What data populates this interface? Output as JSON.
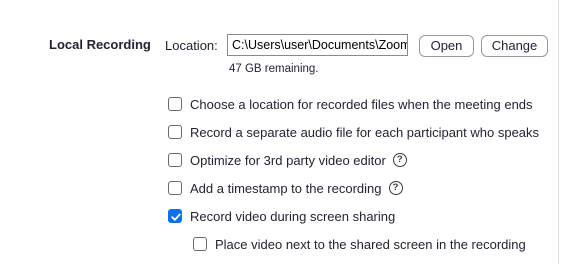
{
  "section": {
    "title": "Local Recording"
  },
  "location": {
    "label": "Location:",
    "value": "C:\\Users\\user\\Documents\\Zoom",
    "open_label": "Open",
    "change_label": "Change",
    "remaining": "47 GB remaining."
  },
  "options": [
    {
      "label": "Choose a location for recorded files when the meeting ends",
      "checked": false,
      "help": false
    },
    {
      "label": "Record a separate audio file for each participant who speaks",
      "checked": false,
      "help": false
    },
    {
      "label": "Optimize for 3rd party video editor",
      "checked": false,
      "help": true
    },
    {
      "label": "Add a timestamp to the recording",
      "checked": false,
      "help": true
    },
    {
      "label": "Record video during screen sharing",
      "checked": true,
      "help": false
    },
    {
      "label": "Place video next to the shared screen in the recording",
      "checked": false,
      "help": false
    }
  ],
  "help_glyph": "?",
  "colors": {
    "accent": "#0e71eb",
    "text": "#232333"
  },
  "icons": {
    "check": "checkmark-icon",
    "help": "help-circle-icon"
  }
}
